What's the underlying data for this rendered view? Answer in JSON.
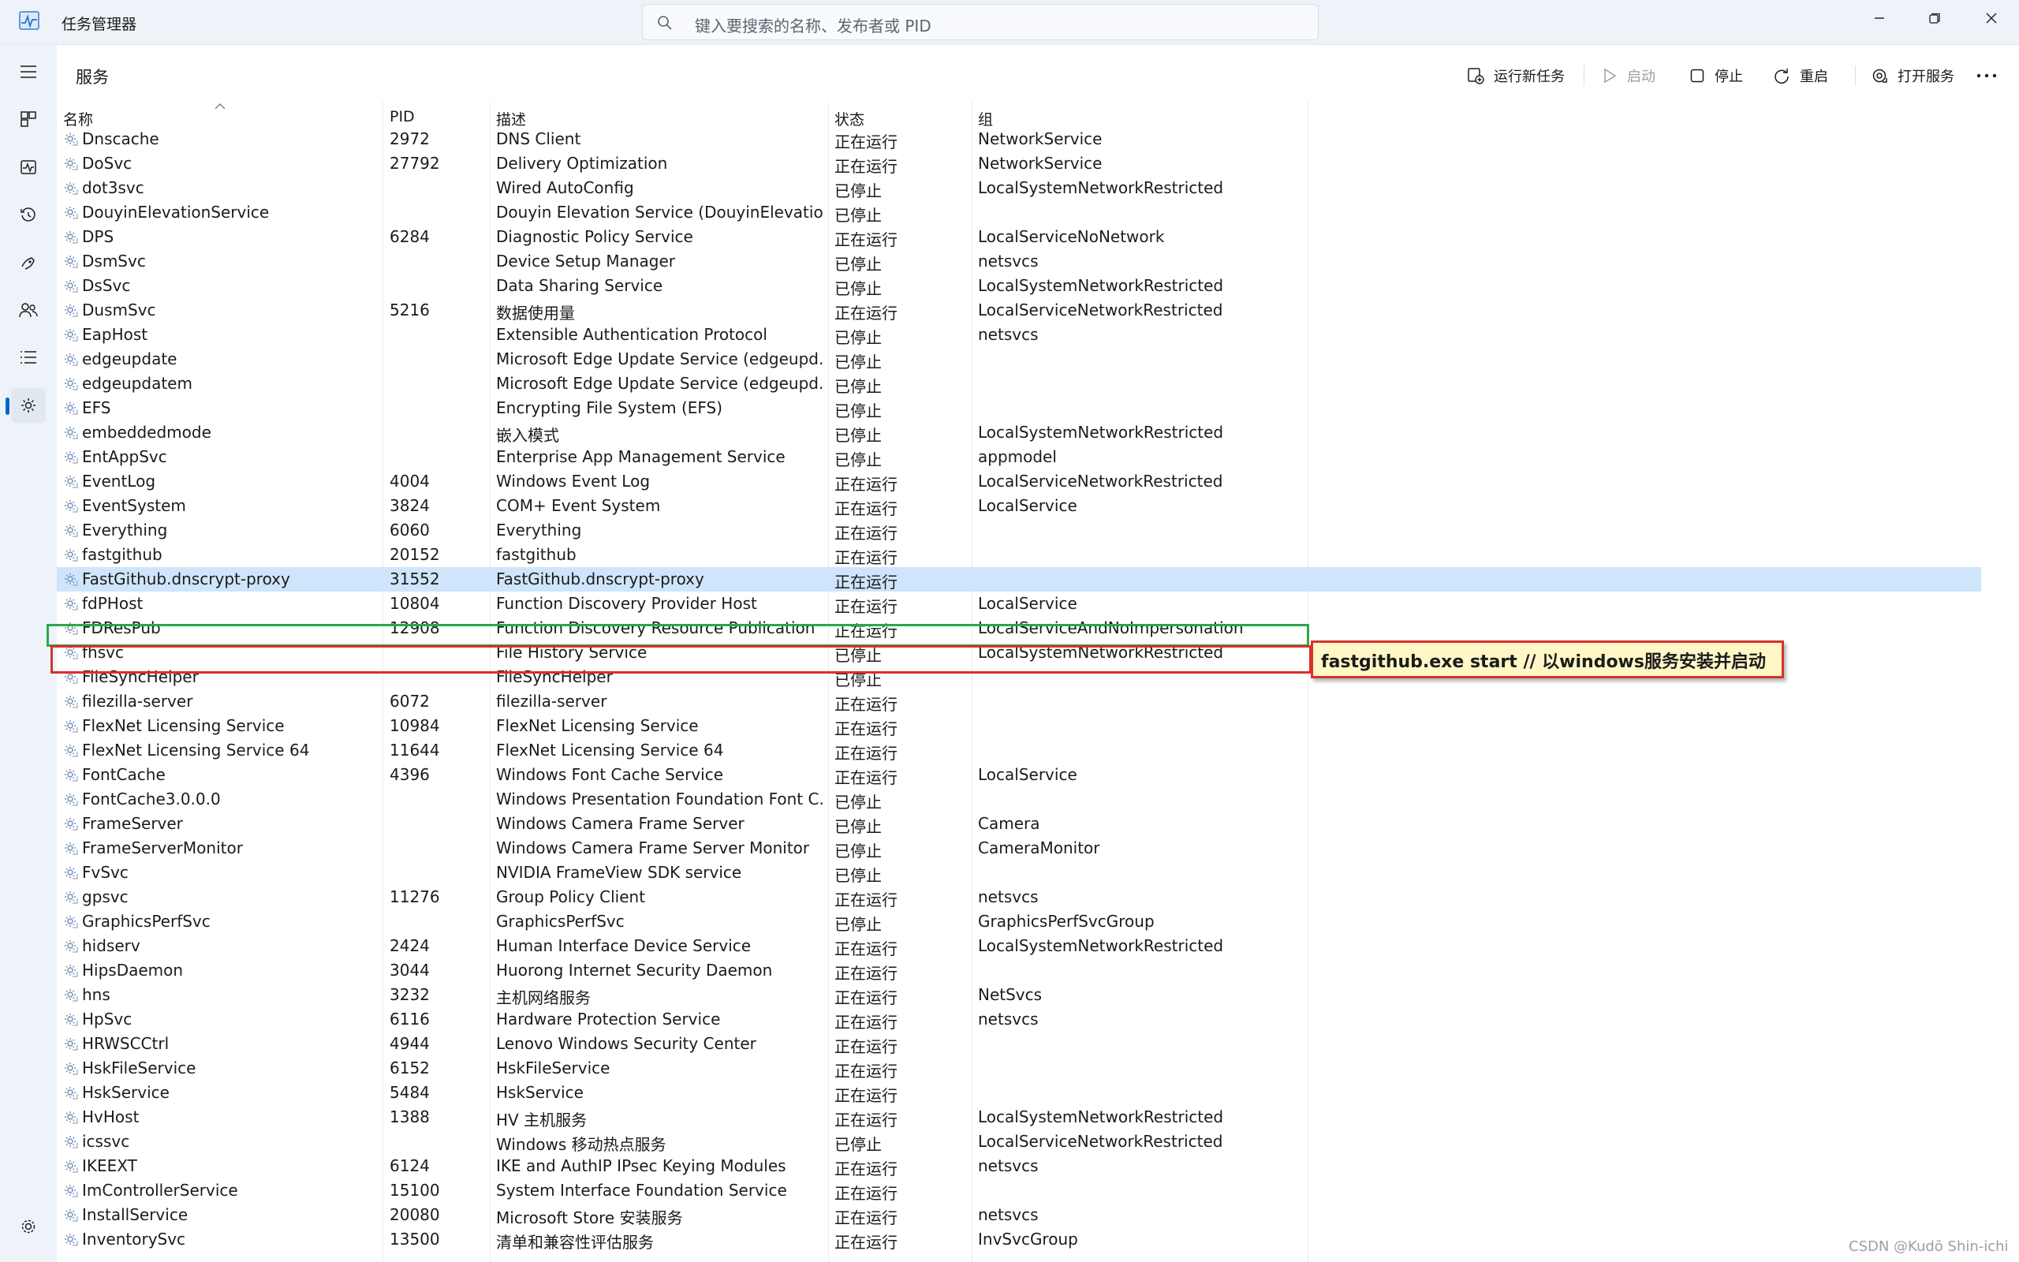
{
  "window": {
    "title": "任务管理器"
  },
  "search": {
    "placeholder": "键入要搜索的名称、发布者或 PID"
  },
  "page": {
    "title": "服务"
  },
  "toolbar": {
    "run_new_task": "运行新任务",
    "start": "启动",
    "stop": "停止",
    "restart": "重启",
    "open_services": "打开服务"
  },
  "columns": {
    "name": "名称",
    "pid": "PID",
    "desc": "描述",
    "status": "状态",
    "group": "组"
  },
  "rows": [
    {
      "name": "Dnscache",
      "pid": "2972",
      "desc": "DNS Client",
      "status": "正在运行",
      "group": "NetworkService"
    },
    {
      "name": "DoSvc",
      "pid": "27792",
      "desc": "Delivery Optimization",
      "status": "正在运行",
      "group": "NetworkService"
    },
    {
      "name": "dot3svc",
      "pid": "",
      "desc": "Wired AutoConfig",
      "status": "已停止",
      "group": "LocalSystemNetworkRestricted"
    },
    {
      "name": "DouyinElevationService",
      "pid": "",
      "desc": "Douyin Elevation Service (DouyinElevatio...",
      "status": "已停止",
      "group": ""
    },
    {
      "name": "DPS",
      "pid": "6284",
      "desc": "Diagnostic Policy Service",
      "status": "正在运行",
      "group": "LocalServiceNoNetwork"
    },
    {
      "name": "DsmSvc",
      "pid": "",
      "desc": "Device Setup Manager",
      "status": "已停止",
      "group": "netsvcs"
    },
    {
      "name": "DsSvc",
      "pid": "",
      "desc": "Data Sharing Service",
      "status": "已停止",
      "group": "LocalSystemNetworkRestricted"
    },
    {
      "name": "DusmSvc",
      "pid": "5216",
      "desc": "数据使用量",
      "status": "正在运行",
      "group": "LocalServiceNetworkRestricted"
    },
    {
      "name": "EapHost",
      "pid": "",
      "desc": "Extensible Authentication Protocol",
      "status": "已停止",
      "group": "netsvcs"
    },
    {
      "name": "edgeupdate",
      "pid": "",
      "desc": "Microsoft Edge Update Service (edgeupd...",
      "status": "已停止",
      "group": ""
    },
    {
      "name": "edgeupdatem",
      "pid": "",
      "desc": "Microsoft Edge Update Service (edgeupd...",
      "status": "已停止",
      "group": ""
    },
    {
      "name": "EFS",
      "pid": "",
      "desc": "Encrypting File System (EFS)",
      "status": "已停止",
      "group": ""
    },
    {
      "name": "embeddedmode",
      "pid": "",
      "desc": "嵌入模式",
      "status": "已停止",
      "group": "LocalSystemNetworkRestricted"
    },
    {
      "name": "EntAppSvc",
      "pid": "",
      "desc": "Enterprise App Management Service",
      "status": "已停止",
      "group": "appmodel"
    },
    {
      "name": "EventLog",
      "pid": "4004",
      "desc": "Windows Event Log",
      "status": "正在运行",
      "group": "LocalServiceNetworkRestricted"
    },
    {
      "name": "EventSystem",
      "pid": "3824",
      "desc": "COM+ Event System",
      "status": "正在运行",
      "group": "LocalService"
    },
    {
      "name": "Everything",
      "pid": "6060",
      "desc": "Everything",
      "status": "正在运行",
      "group": ""
    },
    {
      "name": "fastgithub",
      "pid": "20152",
      "desc": "fastgithub",
      "status": "正在运行",
      "group": ""
    },
    {
      "name": "FastGithub.dnscrypt-proxy",
      "pid": "31552",
      "desc": "FastGithub.dnscrypt-proxy",
      "status": "正在运行",
      "group": ""
    },
    {
      "name": "fdPHost",
      "pid": "10804",
      "desc": "Function Discovery Provider Host",
      "status": "正在运行",
      "group": "LocalService"
    },
    {
      "name": "FDResPub",
      "pid": "12908",
      "desc": "Function Discovery Resource Publication",
      "status": "正在运行",
      "group": "LocalServiceAndNoImpersonation"
    },
    {
      "name": "fhsvc",
      "pid": "",
      "desc": "File History Service",
      "status": "已停止",
      "group": "LocalSystemNetworkRestricted"
    },
    {
      "name": "FileSyncHelper",
      "pid": "",
      "desc": "FileSyncHelper",
      "status": "已停止",
      "group": ""
    },
    {
      "name": "filezilla-server",
      "pid": "6072",
      "desc": "filezilla-server",
      "status": "正在运行",
      "group": ""
    },
    {
      "name": "FlexNet Licensing Service",
      "pid": "10984",
      "desc": "FlexNet Licensing Service",
      "status": "正在运行",
      "group": ""
    },
    {
      "name": "FlexNet Licensing Service 64",
      "pid": "11644",
      "desc": "FlexNet Licensing Service 64",
      "status": "正在运行",
      "group": ""
    },
    {
      "name": "FontCache",
      "pid": "4396",
      "desc": "Windows Font Cache Service",
      "status": "正在运行",
      "group": "LocalService"
    },
    {
      "name": "FontCache3.0.0.0",
      "pid": "",
      "desc": "Windows Presentation Foundation Font C...",
      "status": "已停止",
      "group": ""
    },
    {
      "name": "FrameServer",
      "pid": "",
      "desc": "Windows Camera Frame Server",
      "status": "已停止",
      "group": "Camera"
    },
    {
      "name": "FrameServerMonitor",
      "pid": "",
      "desc": "Windows Camera Frame Server Monitor",
      "status": "已停止",
      "group": "CameraMonitor"
    },
    {
      "name": "FvSvc",
      "pid": "",
      "desc": "NVIDIA FrameView SDK service",
      "status": "已停止",
      "group": ""
    },
    {
      "name": "gpsvc",
      "pid": "11276",
      "desc": "Group Policy Client",
      "status": "正在运行",
      "group": "netsvcs"
    },
    {
      "name": "GraphicsPerfSvc",
      "pid": "",
      "desc": "GraphicsPerfSvc",
      "status": "已停止",
      "group": "GraphicsPerfSvcGroup"
    },
    {
      "name": "hidserv",
      "pid": "2424",
      "desc": "Human Interface Device Service",
      "status": "正在运行",
      "group": "LocalSystemNetworkRestricted"
    },
    {
      "name": "HipsDaemon",
      "pid": "3044",
      "desc": "Huorong Internet Security Daemon",
      "status": "正在运行",
      "group": ""
    },
    {
      "name": "hns",
      "pid": "3232",
      "desc": "主机网络服务",
      "status": "正在运行",
      "group": "NetSvcs"
    },
    {
      "name": "HpSvc",
      "pid": "6116",
      "desc": "Hardware Protection Service",
      "status": "正在运行",
      "group": "netsvcs"
    },
    {
      "name": "HRWSCCtrl",
      "pid": "4944",
      "desc": "Lenovo Windows Security Center",
      "status": "正在运行",
      "group": ""
    },
    {
      "name": "HskFileService",
      "pid": "6152",
      "desc": "HskFileService",
      "status": "正在运行",
      "group": ""
    },
    {
      "name": "HskService",
      "pid": "5484",
      "desc": "HskService",
      "status": "正在运行",
      "group": ""
    },
    {
      "name": "HvHost",
      "pid": "1388",
      "desc": "HV 主机服务",
      "status": "正在运行",
      "group": "LocalSystemNetworkRestricted"
    },
    {
      "name": "icssvc",
      "pid": "",
      "desc": "Windows 移动热点服务",
      "status": "已停止",
      "group": "LocalServiceNetworkRestricted"
    },
    {
      "name": "IKEEXT",
      "pid": "6124",
      "desc": "IKE and AuthIP IPsec Keying Modules",
      "status": "正在运行",
      "group": "netsvcs"
    },
    {
      "name": "ImControllerService",
      "pid": "15100",
      "desc": "System Interface Foundation Service",
      "status": "正在运行",
      "group": ""
    },
    {
      "name": "InstallService",
      "pid": "20080",
      "desc": "Microsoft Store 安装服务",
      "status": "正在运行",
      "group": "netsvcs"
    },
    {
      "name": "InventorySvc",
      "pid": "13500",
      "desc": "清单和兼容性评估服务",
      "status": "正在运行",
      "group": "InvSvcGroup"
    }
  ],
  "annotation": {
    "text": "fastgithub.exe start // 以windows服务安装并启动"
  },
  "watermark": "CSDN @Kudō Shin-ichi",
  "colors": {
    "highlight_green": "#2aa84a",
    "highlight_red": "#d9302c",
    "selection": "#cfe5fb",
    "callout_bg": "#fff7c6",
    "accent": "#0067c0"
  }
}
